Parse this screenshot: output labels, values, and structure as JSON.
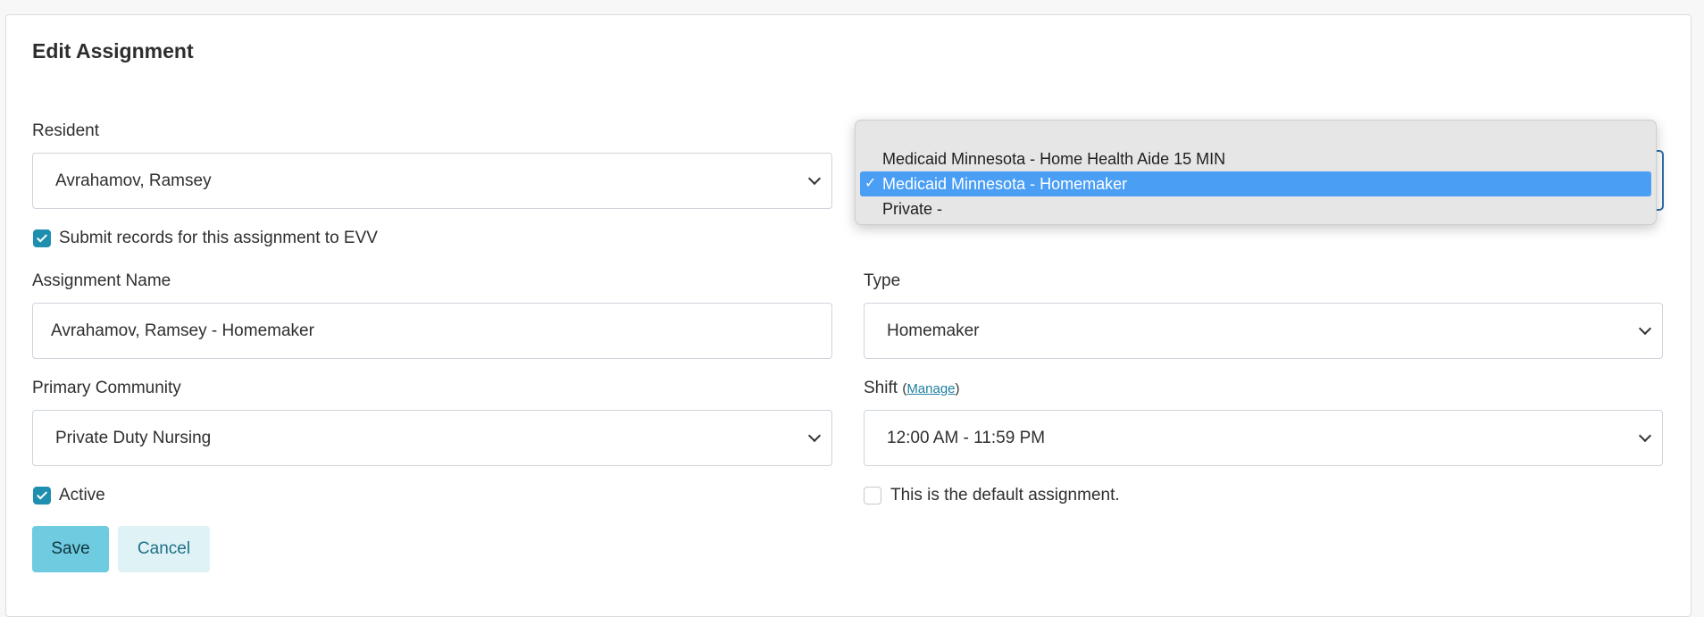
{
  "title": "Edit Assignment",
  "resident": {
    "label": "Resident",
    "value": "Avrahamov, Ramsey"
  },
  "evv": {
    "label": "Submit records for this assignment to EVV",
    "checked": true
  },
  "assignment_name": {
    "label": "Assignment Name",
    "value": "Avrahamov, Ramsey - Homemaker"
  },
  "type": {
    "label": "Type",
    "value": "Homemaker"
  },
  "primary_community": {
    "label": "Primary Community",
    "value": "Private Duty Nursing"
  },
  "shift": {
    "label": "Shift",
    "open_paren": "(",
    "manage_link": "Manage",
    "close_paren": ")",
    "value": "12:00 AM - 11:59 PM"
  },
  "active": {
    "label": "Active",
    "checked": true
  },
  "default_assignment": {
    "label": "This is the default assignment.",
    "checked": false
  },
  "buttons": {
    "save": "Save",
    "cancel": "Cancel"
  },
  "billing_dropdown": {
    "options": [
      {
        "label": "Medicaid Minnesota - Home Health Aide 15 MIN",
        "selected": false
      },
      {
        "label": "Medicaid Minnesota - Homemaker",
        "selected": true
      },
      {
        "label": "Private -",
        "selected": false
      }
    ],
    "check_glyph": "✓"
  },
  "colors": {
    "accent": "#1f8fb0",
    "save_bg": "#6ecbe0",
    "cancel_bg": "#dff3f7",
    "highlight": "#4a9ff5"
  }
}
